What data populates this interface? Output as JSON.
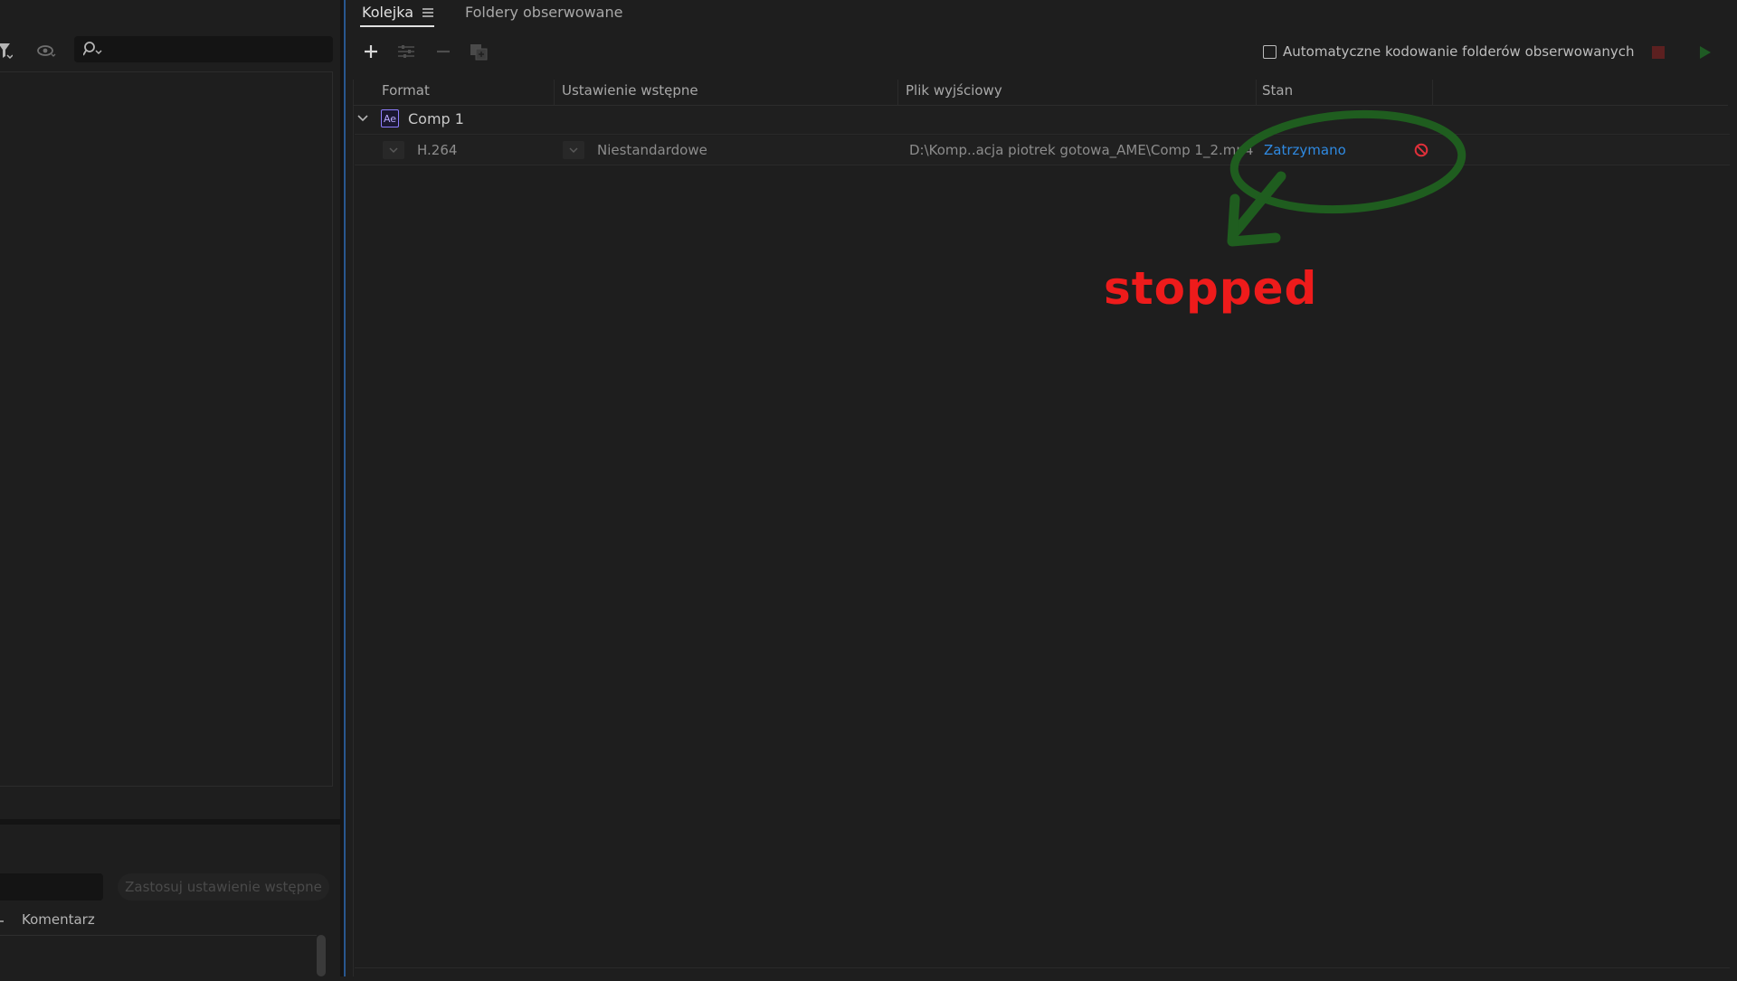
{
  "left_panel": {
    "search": {
      "placeholder": ""
    },
    "preset_name": {
      "value": ""
    },
    "apply_preset_label": "Zastosuj ustawienie wstępne",
    "comment_header": "Komentarz"
  },
  "queue": {
    "tabs": [
      {
        "label": "Kolejka",
        "active": true
      },
      {
        "label": "Foldery obserwowane",
        "active": false
      }
    ],
    "toolbar": {
      "auto_encode_label": "Automatyczne kodowanie folderów obserwowanych",
      "auto_encode_checked": false
    },
    "columns": [
      "Format",
      "Ustawienie wstępne",
      "Plik wyjściowy",
      "Stan"
    ],
    "group": {
      "badge": "Ae",
      "name": "Comp 1",
      "outputs": [
        {
          "format": "H.264",
          "preset": "Niestandardowe",
          "output_file": "D:\\Komp..acja piotrek gotowa_AME\\Comp 1_2.mp4",
          "status": "Zatrzymano"
        }
      ]
    }
  },
  "annotation": {
    "text": "stopped",
    "color": "#ee1b1b",
    "ellipse_color": "#1f5d1f"
  },
  "colors": {
    "status_link": "#2f8ae2",
    "accent_separator": "#2c6fbf",
    "stop_red": "#e0303a"
  }
}
